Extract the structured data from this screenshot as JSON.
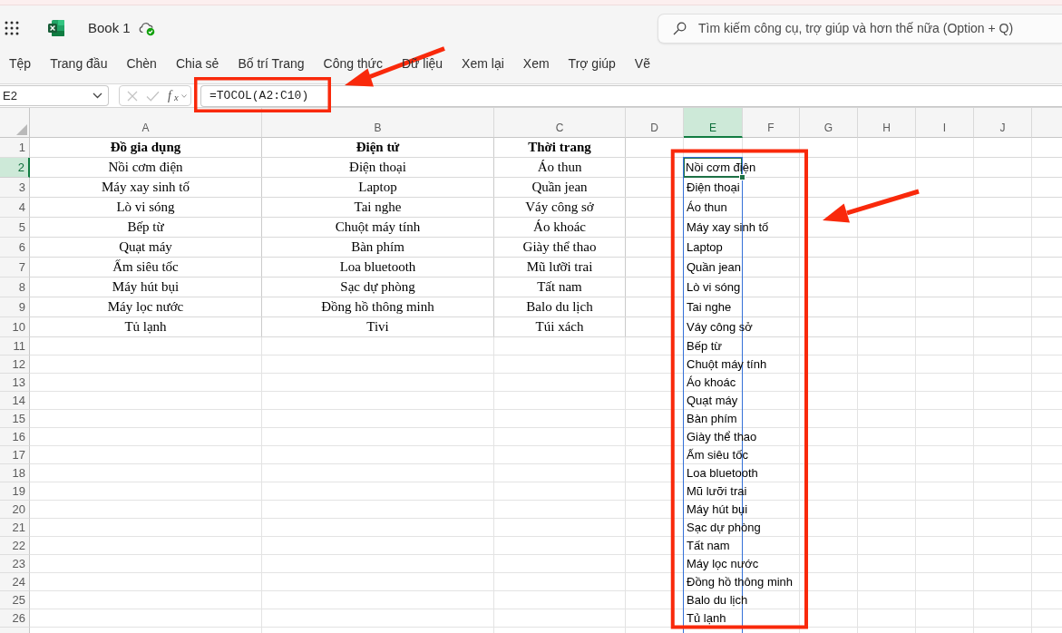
{
  "app_bar": {
    "document_title": "Book 1",
    "search": {
      "placeholder": "Tìm kiếm công cụ, trợ giúp và hơn thế nữa (Option + Q)"
    }
  },
  "menu": [
    "Tệp",
    "Trang đầu",
    "Chèn",
    "Chia sẻ",
    "Bố trí Trang",
    "Công thức",
    "Dữ liệu",
    "Xem lại",
    "Xem",
    "Trợ giúp",
    "Vẽ"
  ],
  "formula_bar": {
    "name_box": "E2",
    "buttons": [
      {
        "kind": "cancel",
        "disabled": true
      },
      {
        "kind": "enter",
        "disabled": true
      }
    ],
    "function_label": "f$_{x}$",
    "formula": "=TOCOL(A2:C10)"
  },
  "sheet": {
    "columns": [
      {
        "label": "A",
        "selected": false,
        "spill_range": false
      },
      {
        "label": "B",
        "selected": false,
        "spill_range": false
      },
      {
        "label": "C",
        "selected": false,
        "spill_range": false
      },
      {
        "label": "D",
        "selected": false,
        "spill_range": false
      },
      {
        "label": "E",
        "selected": true,
        "spill_range": true
      },
      {
        "label": "F",
        "selected": false,
        "spill_range": false
      },
      {
        "label": "G",
        "selected": false,
        "spill_range": false
      },
      {
        "label": "H",
        "selected": false,
        "spill_range": false
      },
      {
        "label": "I",
        "selected": false,
        "spill_range": false
      },
      {
        "label": "J",
        "selected": false,
        "spill_range": false
      }
    ],
    "rows": [
      {
        "header": "1",
        "kind": "heading",
        "selected": false,
        "cells": [
          "Đồ gia dụng",
          "Điện tử",
          "Thời trang"
        ]
      },
      {
        "header": "2",
        "kind": "data",
        "selected": true,
        "cells": [
          "Nồi cơm điện",
          "Điện thoại",
          "Áo thun"
        ],
        "spilled_value": "Nồi cơm điện"
      },
      {
        "header": "3",
        "kind": "data",
        "selected": false,
        "cells": [
          "Máy xay sinh tố",
          "Laptop",
          "Quần jean"
        ],
        "spilled_value": "Điện thoại"
      },
      {
        "header": "4",
        "kind": "data",
        "selected": false,
        "cells": [
          "Lò vi sóng",
          "Tai nghe",
          "Váy công sở"
        ],
        "spilled_value": "Áo thun"
      },
      {
        "header": "5",
        "kind": "data",
        "selected": false,
        "cells": [
          "Bếp từ",
          "Chuột máy tính",
          "Áo khoác"
        ],
        "spilled_value": "Máy xay sinh tố"
      },
      {
        "header": "6",
        "kind": "data",
        "selected": false,
        "cells": [
          "Quạt máy",
          "Bàn phím",
          "Giày thể thao"
        ],
        "spilled_value": "Laptop"
      },
      {
        "header": "7",
        "kind": "data",
        "selected": false,
        "cells": [
          "Ấm siêu tốc",
          "Loa bluetooth",
          "Mũ lưỡi trai"
        ],
        "spilled_value": "Quần jean"
      },
      {
        "header": "8",
        "kind": "data",
        "selected": false,
        "cells": [
          "Máy hút bụi",
          "Sạc dự phòng",
          "Tất nam"
        ],
        "spilled_value": "Lò vi sóng"
      },
      {
        "header": "9",
        "kind": "data",
        "selected": false,
        "cells": [
          "Máy lọc nước",
          "Đồng hồ thông minh",
          "Balo du lịch"
        ],
        "spilled_value": "Tai nghe"
      },
      {
        "header": "10",
        "kind": "data",
        "selected": false,
        "cells": [
          "Tủ lạnh",
          "Tivi",
          "Túi xách"
        ],
        "spilled_value": "Váy công sở"
      },
      {
        "header": "11",
        "kind": "data",
        "selected": false,
        "spilled_value": "Bếp từ"
      },
      {
        "header": "12",
        "kind": "data",
        "selected": false,
        "spilled_value": "Chuột máy tính"
      },
      {
        "header": "13",
        "kind": "data",
        "selected": false,
        "spilled_value": "Áo khoác"
      },
      {
        "header": "14",
        "kind": "data",
        "selected": false,
        "spilled_value": "Quạt máy"
      },
      {
        "header": "15",
        "kind": "data",
        "selected": false,
        "spilled_value": "Bàn phím"
      },
      {
        "header": "16",
        "kind": "data",
        "selected": false,
        "spilled_value": "Giày thể thao"
      },
      {
        "header": "17",
        "kind": "data",
        "selected": false,
        "spilled_value": "Ấm siêu tốc"
      },
      {
        "header": "18",
        "kind": "data",
        "selected": false,
        "spilled_value": "Loa bluetooth"
      },
      {
        "header": "19",
        "kind": "data",
        "selected": false,
        "spilled_value": "Mũ lưỡi trai"
      },
      {
        "header": "20",
        "kind": "data",
        "selected": false,
        "spilled_value": "Máy hút bụi"
      },
      {
        "header": "21",
        "kind": "data",
        "selected": false,
        "spilled_value": "Sạc dự phòng"
      },
      {
        "header": "22",
        "kind": "data",
        "selected": false,
        "spilled_value": "Tất nam"
      },
      {
        "header": "23",
        "kind": "data",
        "selected": false,
        "spilled_value": "Máy lọc nước"
      },
      {
        "header": "24",
        "kind": "data",
        "selected": false,
        "spilled_value": "Đồng hồ thông minh"
      },
      {
        "header": "25",
        "kind": "data",
        "selected": false,
        "spilled_value": "Balo du lịch"
      },
      {
        "header": "26",
        "kind": "data",
        "selected": false,
        "spilled_value": "Tủ lạnh"
      }
    ]
  }
}
